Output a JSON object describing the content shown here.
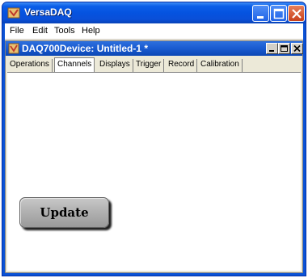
{
  "app": {
    "title": "VersaDAQ",
    "icon": "app-icon"
  },
  "menu": {
    "items": [
      "File",
      "Edit",
      "Tools",
      "Help"
    ]
  },
  "document": {
    "title": "DAQ700Device: Untitled-1 *"
  },
  "tabs": {
    "items": [
      "Operations",
      "Channels",
      "Displays",
      "Trigger",
      "Record",
      "Calibration"
    ],
    "active": "Channels"
  },
  "panel": {
    "update_label": "Update"
  },
  "colors": {
    "titlebar": "#0553e0",
    "close_button": "#c8401b",
    "panel_background": "#ffffff",
    "button_gray": "#b4b4b4"
  }
}
